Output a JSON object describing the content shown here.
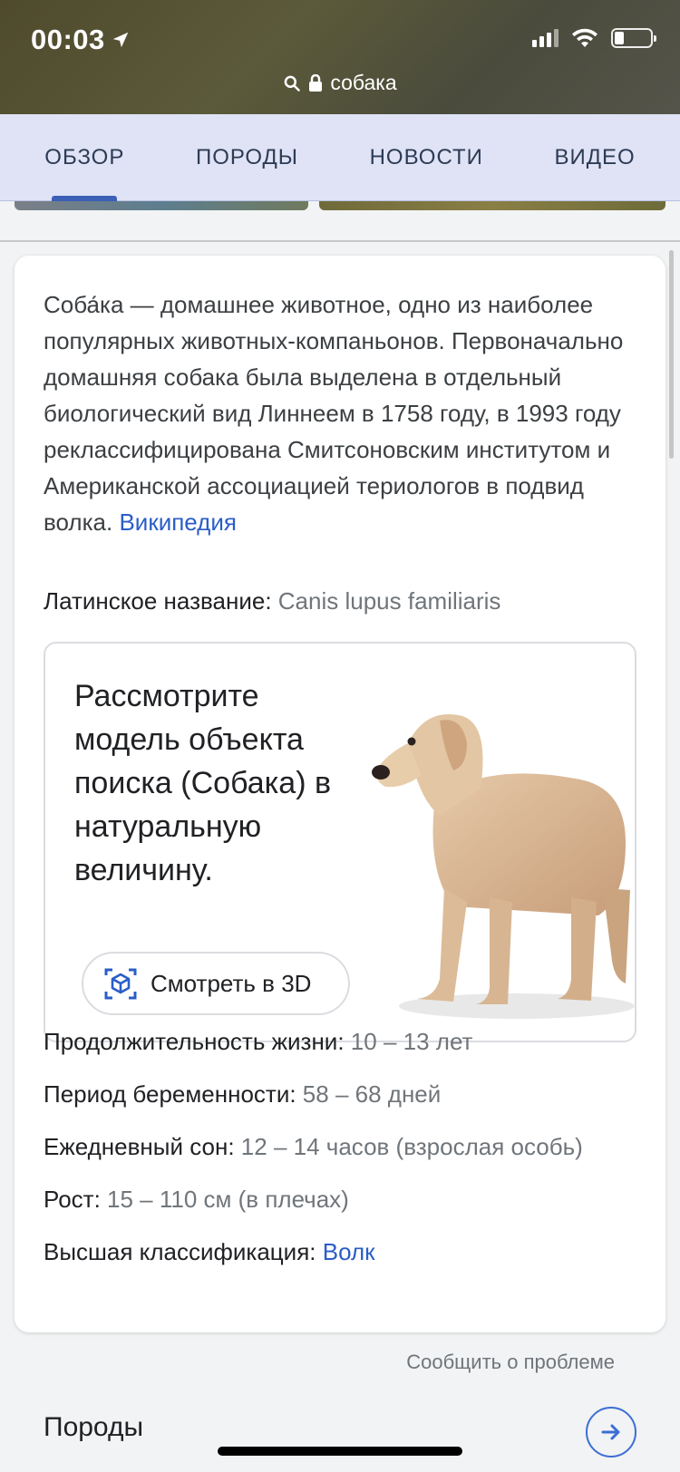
{
  "status": {
    "time": "00:03"
  },
  "url": {
    "query": "собака"
  },
  "tabs": [
    {
      "label": "ОБЗОР"
    },
    {
      "label": "ПОРОДЫ"
    },
    {
      "label": "НОВОСТИ"
    },
    {
      "label": "ВИДЕО"
    }
  ],
  "card": {
    "description": "Соба́ка — домашнее животное, одно из наиболее популярных животных-компаньонов. Первоначально домашняя собака была выделена в отдельный биологический вид Линнеем в 1758 году, в 1993 году реклассифицирована Смитсоновским институтом и Американской ассоциацией териологов в подвид волка.",
    "source_link": "Википедия",
    "latin": {
      "label": "Латинское название:",
      "value": "Canis lupus familiaris"
    },
    "model": {
      "text": "Рассмотрите модель объекта поиска (Собака) в натуральную величину.",
      "button": "Смотреть в 3D"
    },
    "facts": [
      {
        "label": "Продолжительность жизни:",
        "value": "10 – 13 лет"
      },
      {
        "label": "Период беременности:",
        "value": "58 – 68 дней"
      },
      {
        "label": "Ежедневный сон:",
        "value": "12 – 14 часов (взрослая особь)"
      },
      {
        "label": "Рост:",
        "value": "15 – 110 см (в плечах)"
      }
    ],
    "classification": {
      "label": "Высшая классификация:",
      "value": "Волк"
    }
  },
  "report_link": "Сообщить о проблеме",
  "breeds_section": {
    "title": "Породы"
  },
  "colors": {
    "accent": "#3c5fb7",
    "link": "#2a5dc7",
    "tabs_bg": "#dfe3f5"
  }
}
